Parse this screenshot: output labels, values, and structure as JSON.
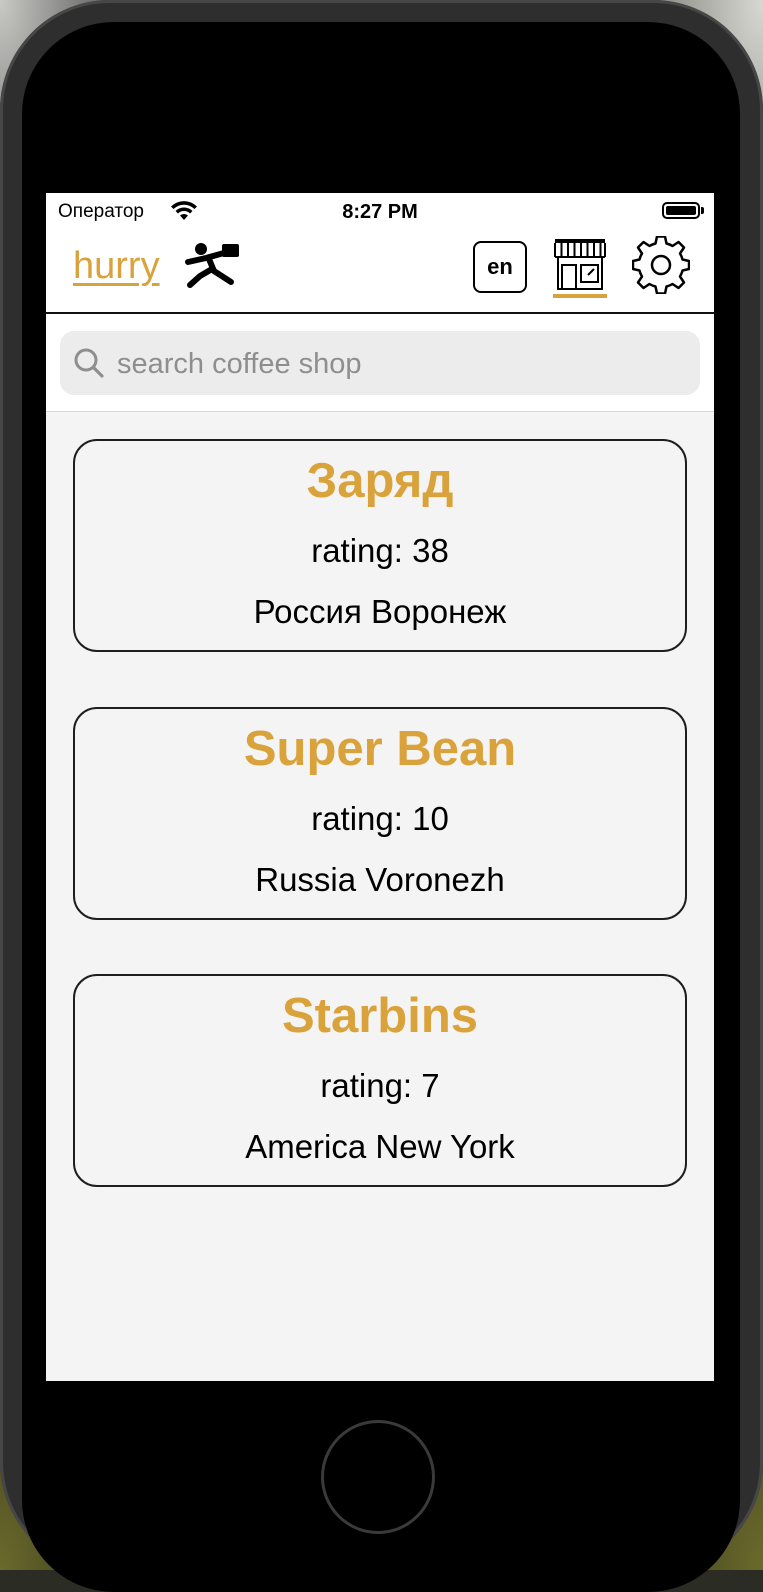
{
  "status_bar": {
    "carrier": "Оператор",
    "time": "8:27 PM"
  },
  "nav": {
    "logo_text": "hurry",
    "language_button": "en",
    "icons": [
      "runner-icon",
      "shop-icon",
      "gear-icon"
    ],
    "active_tab": "shop-icon"
  },
  "search": {
    "placeholder": "search coffee shop",
    "value": ""
  },
  "shops": [
    {
      "name": "Заряд",
      "rating": "rating: 38",
      "location": "Россия Воронеж"
    },
    {
      "name": "Super Bean",
      "rating": "rating: 10",
      "location": "Russia Voronezh"
    },
    {
      "name": "Starbins",
      "rating": "rating: 7",
      "location": "America New York"
    }
  ],
  "colors": {
    "accent": "#d9a23a",
    "text": "#000000",
    "list_background": "#f4f4f4"
  }
}
